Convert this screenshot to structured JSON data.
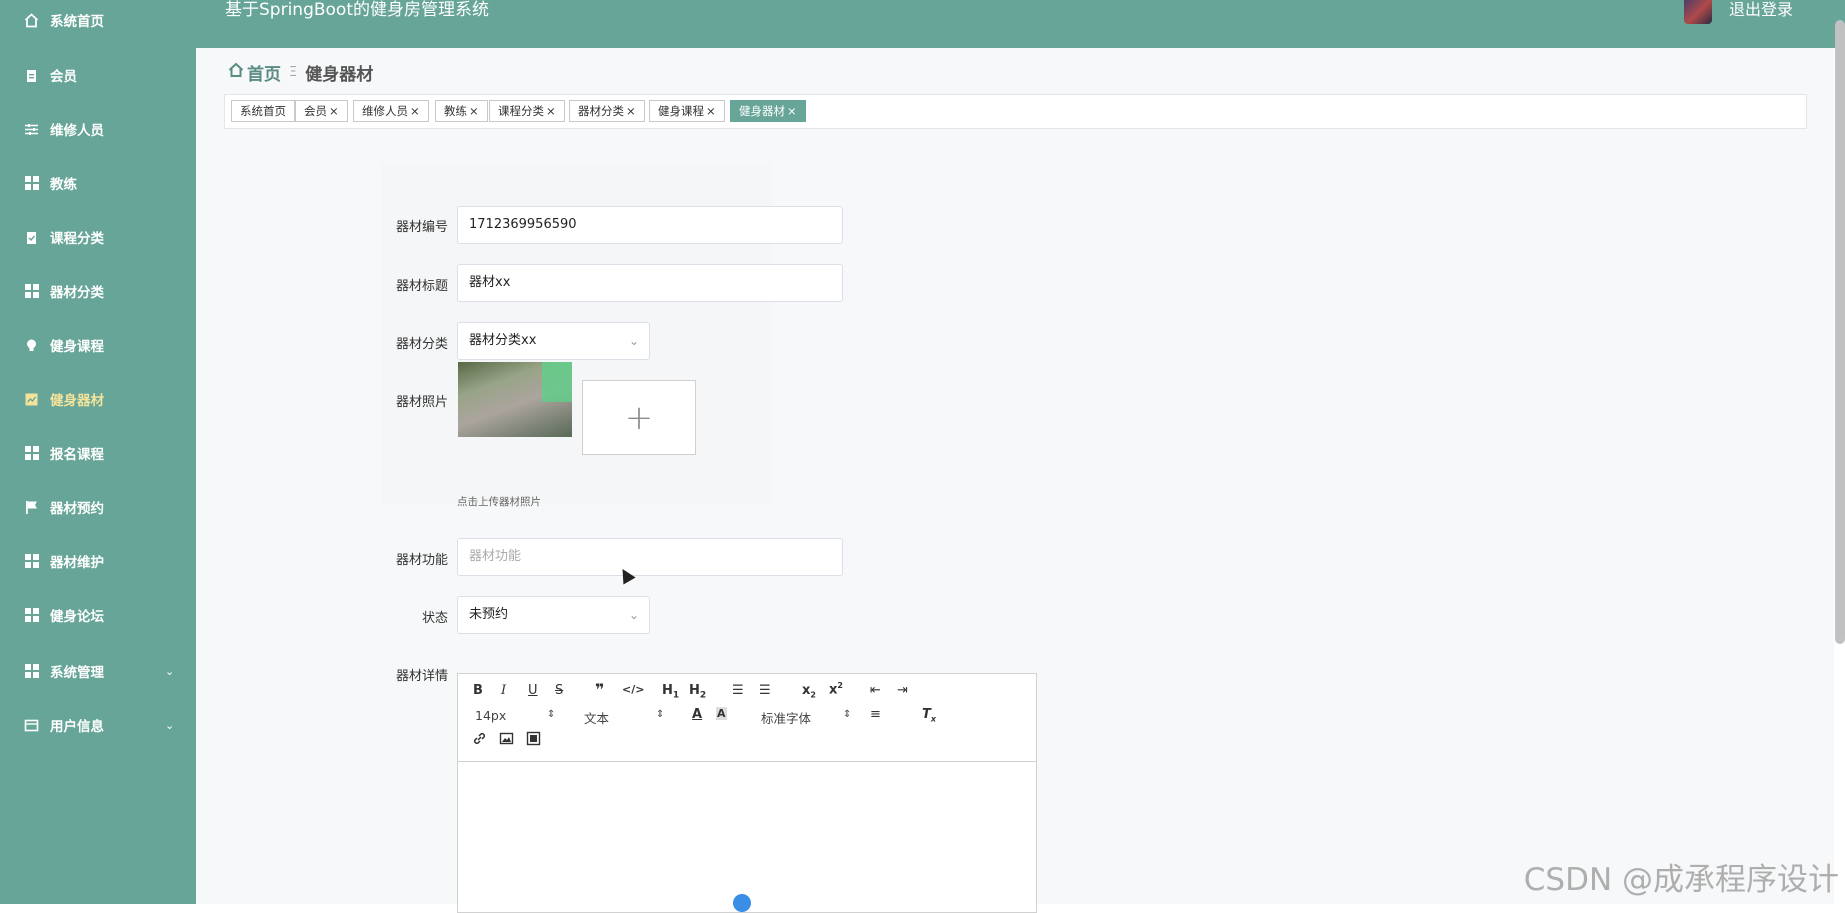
{
  "app": {
    "title": "基于SpringBoot的健身房管理系统",
    "logout": "退出登录"
  },
  "colors": {
    "accent": "#66a597",
    "active_menu_text": "#f3e39b"
  },
  "sidebar": {
    "items": [
      {
        "label": "系统首页",
        "icon": "home-icon"
      },
      {
        "label": "会员",
        "icon": "clipboard-icon"
      },
      {
        "label": "维修人员",
        "icon": "sliders-icon"
      },
      {
        "label": "教练",
        "icon": "grid-icon"
      },
      {
        "label": "课程分类",
        "icon": "clipboard-icon"
      },
      {
        "label": "器材分类",
        "icon": "grid-icon"
      },
      {
        "label": "健身课程",
        "icon": "lightbulb-icon"
      },
      {
        "label": "健身器材",
        "icon": "chart-icon",
        "active": true
      },
      {
        "label": "报名课程",
        "icon": "grid-icon"
      },
      {
        "label": "器材预约",
        "icon": "flag-icon"
      },
      {
        "label": "器材维护",
        "icon": "grid-icon"
      },
      {
        "label": "健身论坛",
        "icon": "grid-icon"
      },
      {
        "label": "系统管理",
        "icon": "grid-icon",
        "expandable": true
      },
      {
        "label": "用户信息",
        "icon": "card-icon",
        "expandable": true
      }
    ]
  },
  "breadcrumb": {
    "home": "首页",
    "current": "健身器材"
  },
  "tags": [
    {
      "label": "系统首页",
      "closable": false
    },
    {
      "label": "会员",
      "closable": true
    },
    {
      "label": "维修人员",
      "closable": true
    },
    {
      "label": "教练",
      "closable": true
    },
    {
      "label": "课程分类",
      "closable": true
    },
    {
      "label": "器材分类",
      "closable": true
    },
    {
      "label": "健身课程",
      "closable": true
    },
    {
      "label": "健身器材",
      "closable": true,
      "active": true
    }
  ],
  "form": {
    "code_label": "器材编号",
    "code_value": "1712369956590",
    "title_label": "器材标题",
    "title_value": "器材xx",
    "category_label": "器材分类",
    "category_value": "器材分类xx",
    "photo_label": "器材照片",
    "upload_hint": "点击上传器材照片",
    "function_label": "器材功能",
    "function_placeholder": "器材功能",
    "status_label": "状态",
    "status_value": "未预约",
    "detail_label": "器材详情"
  },
  "editor": {
    "font_size": "14px",
    "block_type": "文本",
    "font_family": "标准字体"
  },
  "watermark": "CSDN @成承程序设计"
}
